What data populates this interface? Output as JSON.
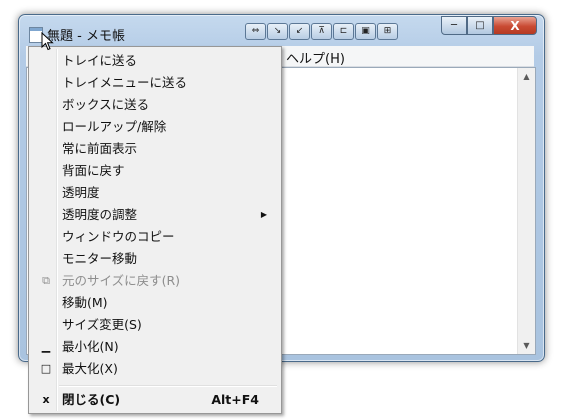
{
  "window": {
    "title": "無題 - メモ帳",
    "menubar_visible_item": "ヘルプ(H)",
    "caption_buttons": {
      "minimize": "─",
      "maximize": "□",
      "close": "X"
    }
  },
  "tool_buttons": [
    {
      "glyph": "⇔",
      "icon": "send-to-tray-icon"
    },
    {
      "glyph": "↘",
      "icon": "tray-menu-icon"
    },
    {
      "glyph": "↙",
      "icon": "box-icon"
    },
    {
      "glyph": "⊼",
      "icon": "rollup-icon"
    },
    {
      "glyph": "⊏",
      "icon": "topmost-icon"
    },
    {
      "glyph": "▣",
      "icon": "transparency-icon"
    },
    {
      "glyph": "⊞",
      "icon": "copy-window-icon"
    }
  ],
  "context_menu": {
    "items": [
      {
        "label": "トレイに送る"
      },
      {
        "label": "トレイメニューに送る"
      },
      {
        "label": "ボックスに送る"
      },
      {
        "label": "ロールアップ/解除"
      },
      {
        "label": "常に前面表示"
      },
      {
        "label": "背面に戻す"
      },
      {
        "label": "透明度"
      },
      {
        "label": "透明度の調整",
        "submenu": "▶"
      },
      {
        "label": "ウィンドウのコピー"
      },
      {
        "label": "モニター移動"
      },
      {
        "label": "元のサイズに戻す(R)",
        "icon_glyph": "⧉",
        "disabled": true
      },
      {
        "label": "移動(M)"
      },
      {
        "label": "サイズ変更(S)"
      },
      {
        "label": "最小化(N)",
        "icon_glyph": "▁"
      },
      {
        "label": "最大化(X)",
        "icon_glyph": "□"
      },
      {
        "label": "閉じる(C)",
        "icon_glyph": "x",
        "shortcut": "Alt+F4",
        "bold": true
      }
    ]
  },
  "scrollbar": {
    "up": "▲",
    "down": "▼"
  }
}
